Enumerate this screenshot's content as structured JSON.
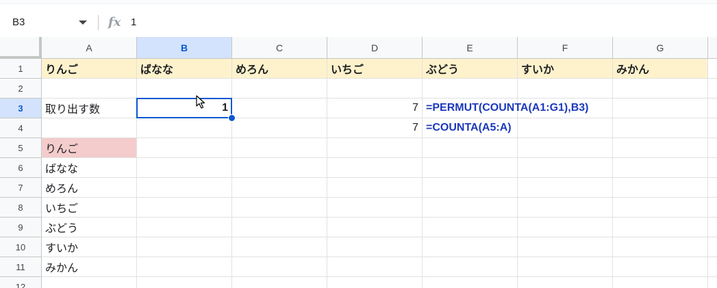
{
  "formula_bar": {
    "name_box": "B3",
    "fx_label": "fx",
    "value": "1"
  },
  "columns": [
    "A",
    "B",
    "C",
    "D",
    "E",
    "F",
    "G"
  ],
  "rows": [
    "1",
    "2",
    "3",
    "4",
    "5",
    "6",
    "7",
    "8",
    "9",
    "10",
    "11",
    "12"
  ],
  "cells": {
    "A1": "りんご",
    "B1": "ばなな",
    "C1": "めろん",
    "D1": "いちご",
    "E1": "ぶどう",
    "F1": "すいか",
    "G1": "みかん",
    "A3": "取り出す数",
    "B3": "1",
    "D3": "7",
    "E3": "=PERMUT(COUNTA(A1:G1),B3)",
    "D4": "7",
    "E4": "=COUNTA(A5:A)",
    "A5": "りんご",
    "A6": "ばなな",
    "A7": "めろん",
    "A8": "いちご",
    "A9": "ぶどう",
    "A10": "すいか",
    "A11": "みかん"
  },
  "selection": {
    "cell": "B3",
    "column": "B",
    "row": "3"
  },
  "colors": {
    "header_fill": "#fef2cc",
    "highlight_fill": "#f4cccc",
    "selection_accent": "#0b57d0",
    "formula_text": "#1c39bb"
  }
}
